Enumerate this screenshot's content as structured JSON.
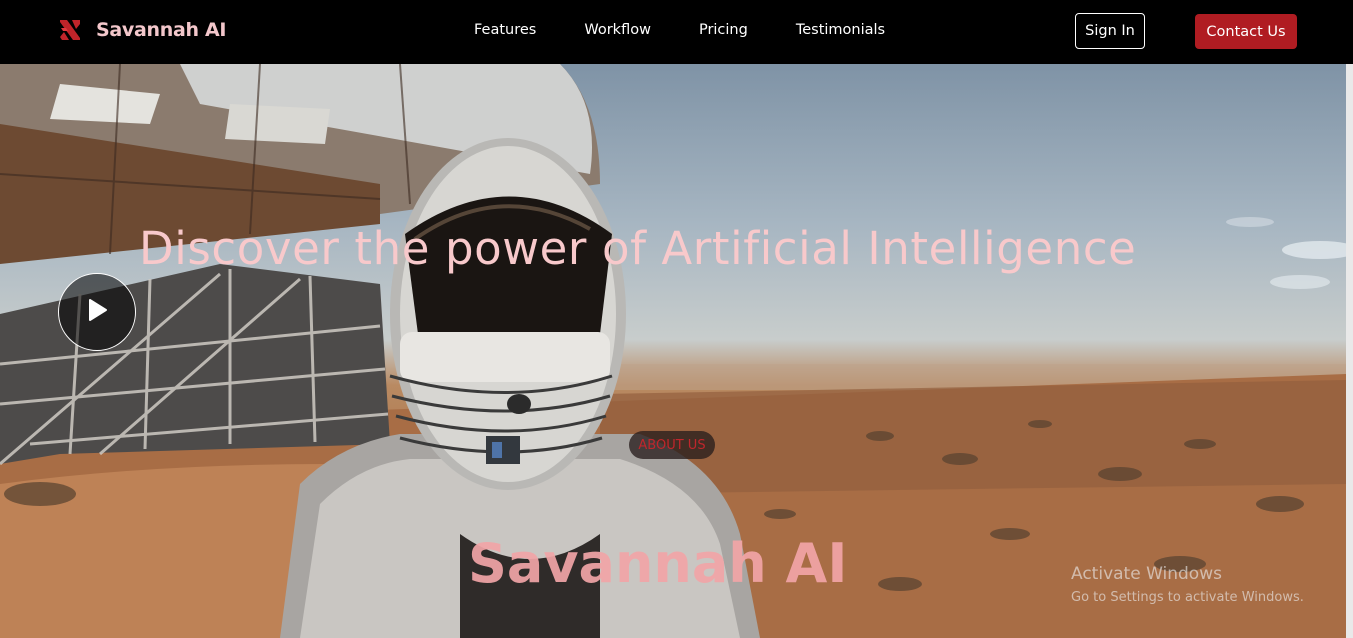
{
  "navbar": {
    "brand_name": "Savannah AI",
    "logo_icon": "red-x-logo-icon",
    "links": [
      "Features",
      "Workflow",
      "Pricing",
      "Testimonials"
    ],
    "sign_in_label": "Sign In",
    "contact_label": "Contact Us"
  },
  "hero": {
    "heading": "Discover the power of Artificial Intelligence",
    "play_icon": "play-icon"
  },
  "about": {
    "badge": "ABOUT US",
    "title": "Savannah AI"
  },
  "watermark": {
    "title": "Activate Windows",
    "subtitle": "Go to Settings to activate Windows."
  },
  "colors": {
    "accent": "#b01c22",
    "brand_text": "#f3c7cb",
    "heading_pink": "#f8c9cb",
    "navbar_bg": "#000000"
  }
}
